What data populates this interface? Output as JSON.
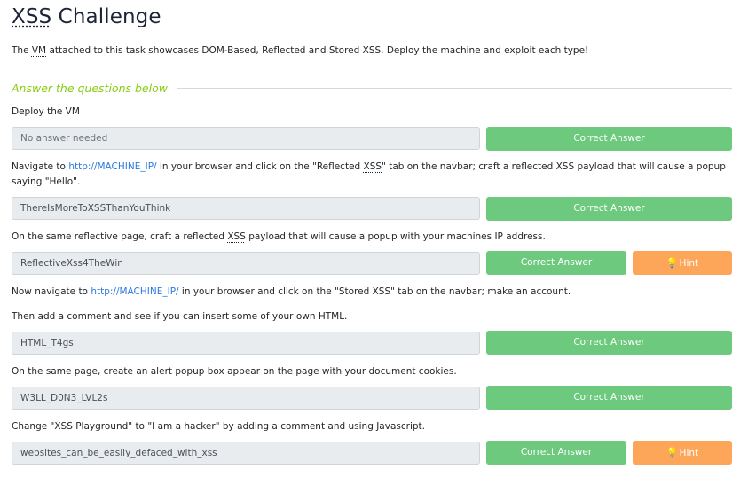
{
  "title": {
    "text_abbr": "XSS",
    "text_rest": " Challenge"
  },
  "intro": {
    "part1": "The ",
    "abbr": "VM",
    "part2": " attached to this task showcases DOM-Based, Reflected and Stored XSS. Deploy the machine and exploit each type!"
  },
  "section": {
    "title": "Answer the questions below"
  },
  "questions": [
    {
      "text": "Deploy the VM",
      "answer": "No answer needed",
      "button": "Correct Answer"
    },
    {
      "text_before": "Navigate to ",
      "link": "http://MACHINE_IP/",
      "text_mid": " in your browser and click on the \"Reflected ",
      "abbr": "XSS",
      "text_after": "\" tab on the navbar; craft a reflected XSS payload that will cause a popup saying \"Hello\".",
      "answer": "ThereIsMoreToXSSThanYouThink",
      "button": "Correct Answer"
    },
    {
      "text_before": "On the same reflective page, craft a reflected ",
      "abbr": "XSS",
      "text_after": " payload that will cause a popup with your machines IP address.",
      "answer": "ReflectiveXss4TheWin",
      "button": "Correct Answer",
      "hint": "Hint"
    },
    {
      "text_before": "Now navigate to ",
      "link": "http://MACHINE_IP/",
      "text_after": " in your browser and click on the \"Stored XSS\" tab on the navbar; make an account.",
      "text_line2": "Then add a comment and see if you can insert some of your own HTML.",
      "answer": "HTML_T4gs",
      "button": "Correct Answer"
    },
    {
      "text": "On the same page, create an alert popup box appear on the page with your document cookies.",
      "answer": "W3LL_D0N3_LVL2s",
      "button": "Correct Answer"
    },
    {
      "text": "Change \"XSS Playground\" to \"I am a hacker\" by adding a comment and using Javascript.",
      "answer": "websites_can_be_easily_defaced_with_xss",
      "button": "Correct Answer",
      "hint": "Hint"
    }
  ]
}
